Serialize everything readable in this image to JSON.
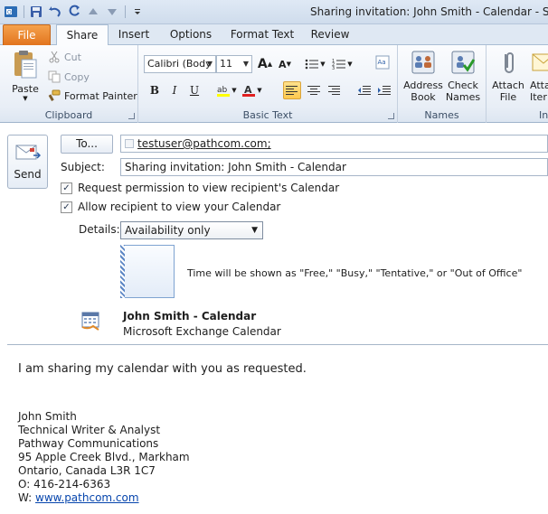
{
  "window": {
    "title": "Sharing invitation: John Smith - Calendar - Share"
  },
  "tabs": [
    {
      "label": "File"
    },
    {
      "label": "Share"
    },
    {
      "label": "Insert"
    },
    {
      "label": "Options"
    },
    {
      "label": "Format Text"
    },
    {
      "label": "Review"
    }
  ],
  "ribbon": {
    "clipboard": {
      "label": "Clipboard",
      "paste": "Paste",
      "cut": "Cut",
      "copy": "Copy",
      "format_painter": "Format Painter"
    },
    "basic_text": {
      "label": "Basic Text",
      "font": "Calibri (Body",
      "size": "11"
    },
    "names": {
      "label": "Names",
      "address_book_1": "Address",
      "address_book_2": "Book",
      "check_names_1": "Check",
      "check_names_2": "Names"
    },
    "include": {
      "label": "Inc",
      "attach_1": "Attach",
      "attach_2": "File",
      "attach_item_1": "Atta",
      "attach_item_2": "Iter"
    }
  },
  "compose": {
    "send": "Send",
    "to_button": "To...",
    "to_value": "testuser@pathcom.com;",
    "subject_label": "Subject:",
    "subject_value": "Sharing invitation: John Smith - Calendar",
    "request_permission": "Request permission to view recipient's Calendar",
    "allow_view": "Allow recipient to view your Calendar",
    "details_label": "Details:",
    "details_value": "Availability only",
    "details_note": "Time will be shown as \"Free,\" \"Busy,\" \"Tentative,\" or \"Out of Office\"",
    "calendar_name": "John Smith - Calendar",
    "calendar_type": "Microsoft Exchange Calendar"
  },
  "body": {
    "message": "I am sharing my calendar with you as requested.",
    "signature": [
      "John Smith",
      "Technical Writer & Analyst",
      "Pathway Communications",
      "95 Apple Creek Blvd., Markham",
      "Ontario, Canada L3R 1C7",
      "O: 416-214-6363"
    ],
    "web_prefix": "W: ",
    "web_link": "www.pathcom.com"
  }
}
